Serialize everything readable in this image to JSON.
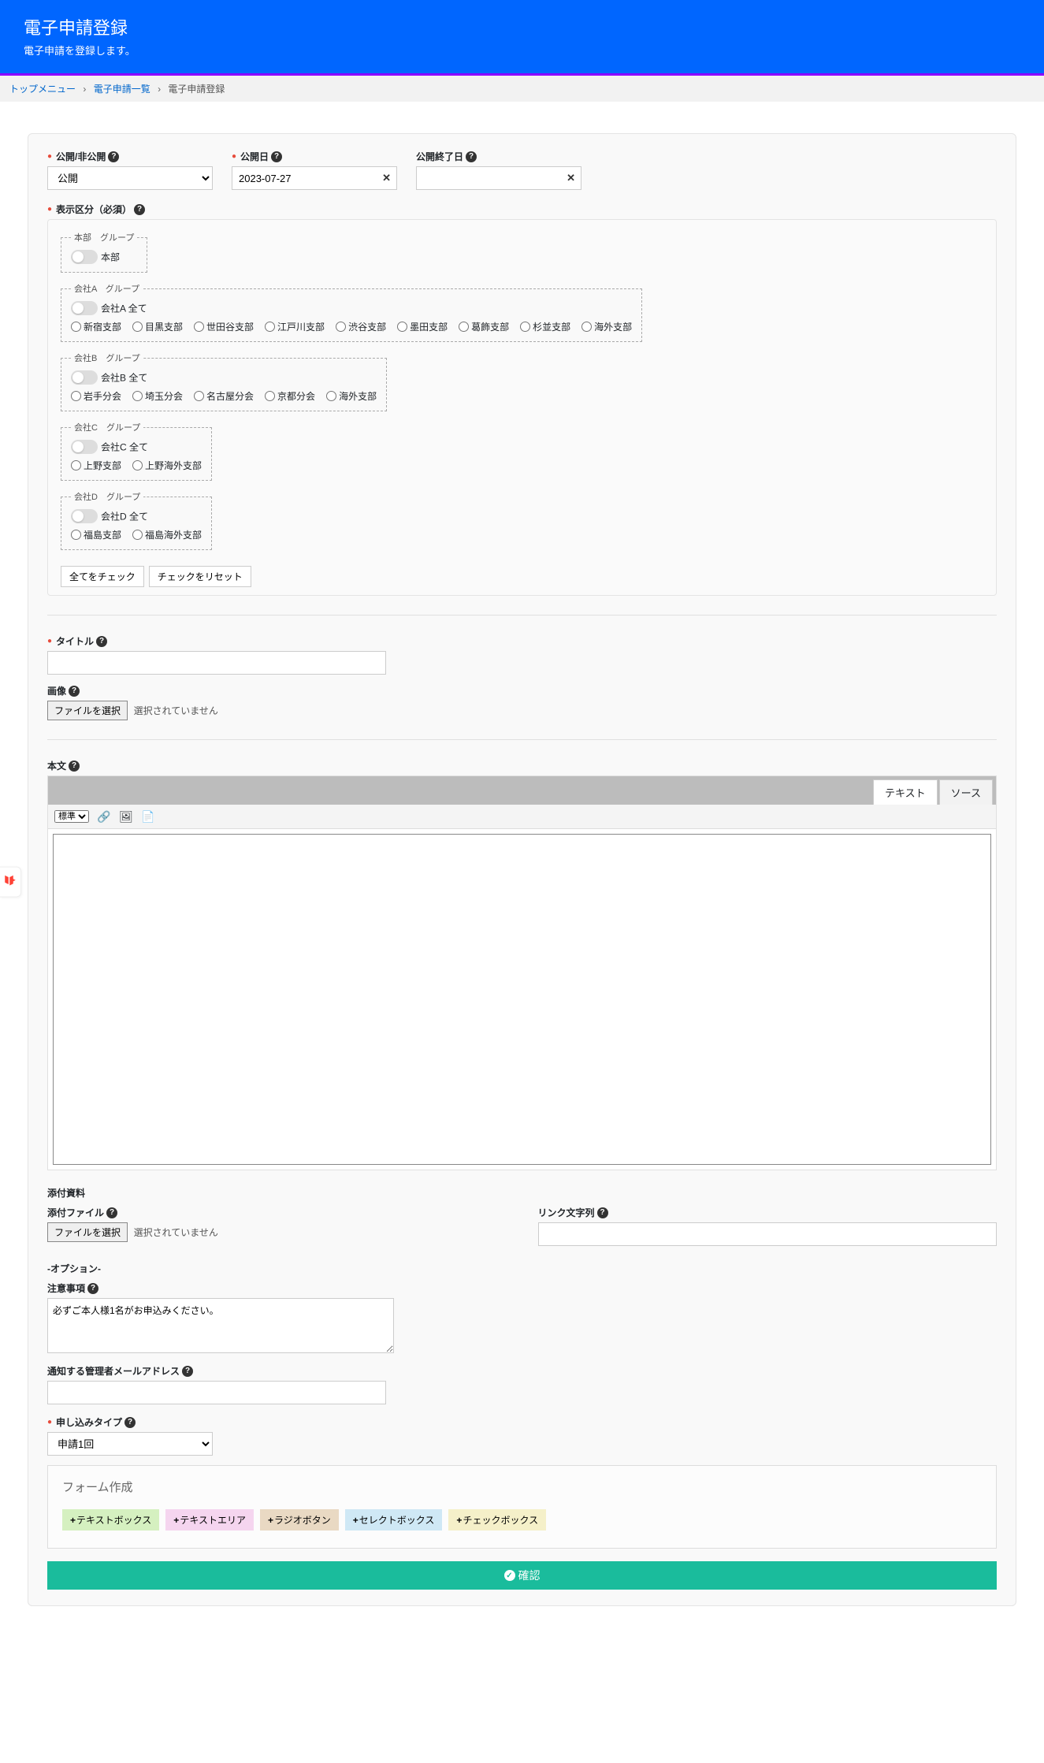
{
  "header": {
    "title": "電子申請登録",
    "subtitle": "電子申請を登録します。"
  },
  "breadcrumb": {
    "top": "トップメニュー",
    "list": "電子申請一覧",
    "current": "電子申請登録"
  },
  "publish": {
    "visibility_label": "公開/非公開",
    "visibility_value": "公開",
    "date_label": "公開日",
    "date_value": "2023-07-27",
    "end_label": "公開終了日",
    "end_value": ""
  },
  "display_group": {
    "label": "表示区分（必須）",
    "groups": [
      {
        "legend": "本部　グループ",
        "toggle_label": "本部",
        "items": []
      },
      {
        "legend": "会社A　グループ",
        "toggle_label": "会社A 全て",
        "items": [
          "新宿支部",
          "目黒支部",
          "世田谷支部",
          "江戸川支部",
          "渋谷支部",
          "墨田支部",
          "葛飾支部",
          "杉並支部",
          "海外支部"
        ]
      },
      {
        "legend": "会社B　グループ",
        "toggle_label": "会社B 全て",
        "items": [
          "岩手分会",
          "埼玉分会",
          "名古屋分会",
          "京都分会",
          "海外支部"
        ]
      },
      {
        "legend": "会社C　グループ",
        "toggle_label": "会社C 全て",
        "items": [
          "上野支部",
          "上野海外支部"
        ]
      },
      {
        "legend": "会社D　グループ",
        "toggle_label": "会社D 全て",
        "items": [
          "福島支部",
          "福島海外支部"
        ]
      }
    ],
    "check_all": "全てをチェック",
    "reset": "チェックをリセット"
  },
  "title_field": {
    "label": "タイトル",
    "value": ""
  },
  "image_field": {
    "label": "画像",
    "button": "ファイルを選択",
    "status": "選択されていません"
  },
  "body_field": {
    "label": "本文",
    "tab_text": "テキスト",
    "tab_source": "ソース",
    "format_select": "標準"
  },
  "attachments": {
    "heading": "添付資料",
    "file_label": "添付ファイル",
    "file_button": "ファイルを選択",
    "file_status": "選択されていません",
    "link_label": "リンク文字列",
    "link_value": ""
  },
  "options": {
    "heading": "-オプション-",
    "note_label": "注意事項",
    "note_value": "必ずご本人様1名がお申込みください。",
    "email_label": "通知する管理者メールアドレス",
    "email_value": ""
  },
  "apply_type": {
    "label": "申し込みタイプ",
    "value": "申請1回"
  },
  "form_builder": {
    "title": "フォーム作成",
    "buttons": [
      "テキストボックス",
      "テキストエリア",
      "ラジオボタン",
      "セレクトボックス",
      "チェックボックス"
    ]
  },
  "submit": "確認"
}
